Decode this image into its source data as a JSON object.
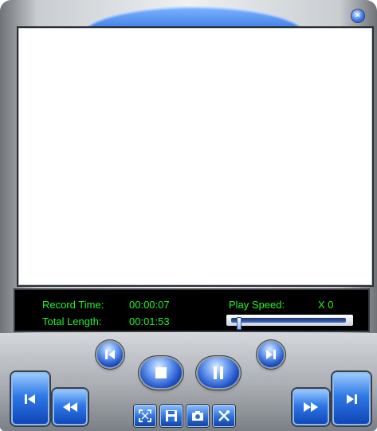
{
  "window": {
    "close_icon": "close-icon"
  },
  "info": {
    "record_time_label": "Record Time:",
    "record_time_value": "00:00:07",
    "total_length_label": "Total Length:",
    "total_length_value": "00:01:53",
    "play_speed_label": "Play Speed:",
    "play_speed_value": "X 0",
    "speed_slider_position": 0.05
  },
  "controls": {
    "prev_frame_icon": "step-back-icon",
    "next_frame_icon": "step-forward-icon",
    "stop_icon": "stop-icon",
    "pause_icon": "pause-icon",
    "skip_start_icon": "skip-to-start-icon",
    "rewind_icon": "rewind-icon",
    "fast_forward_icon": "fast-forward-icon",
    "skip_end_icon": "skip-to-end-icon",
    "fullscreen_icon": "fullscreen-icon",
    "save_icon": "save-icon",
    "snapshot_icon": "camera-icon",
    "settings_icon": "tools-icon"
  },
  "colors": {
    "display_text": "#1ff62a",
    "button_blue": "#1c4fc3",
    "panel_bg": "#000000"
  }
}
